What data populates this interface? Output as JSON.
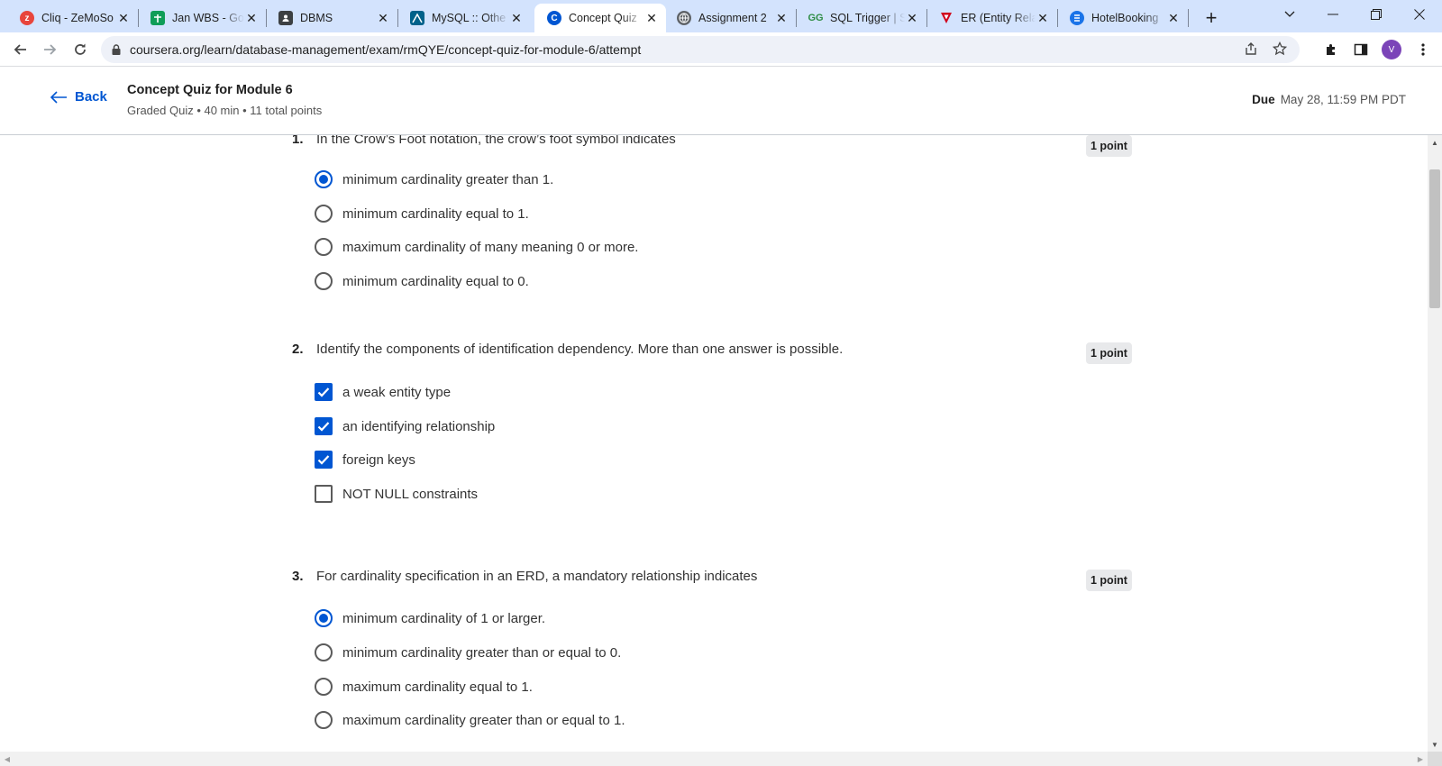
{
  "browser": {
    "tabs": [
      {
        "title": "Cliq - ZeMoSo",
        "icon": "zoho-cliq-icon",
        "color": "#e8453c"
      },
      {
        "title": "Jan WBS - Goo",
        "icon": "google-sheets-icon",
        "color": "#0f9d58"
      },
      {
        "title": "DBMS",
        "icon": "profile-card-icon",
        "color": "#3c4043"
      },
      {
        "title": "MySQL :: Othe",
        "icon": "mysql-icon",
        "color": "#00618a"
      },
      {
        "title": "Concept Quiz",
        "icon": "coursera-icon",
        "color": "#0056d2"
      },
      {
        "title": "Assignment 2",
        "icon": "globe-icon",
        "color": "#5f6368"
      },
      {
        "title": "SQL Trigger | S",
        "icon": "geeksforgeeks-icon",
        "color": "#2f8d46"
      },
      {
        "title": "ER (Entity Rela",
        "icon": "vertabelo-icon",
        "color": "#d0021b"
      },
      {
        "title": "HotelBooking",
        "icon": "database-icon",
        "color": "#1a73e8"
      }
    ],
    "active_tab_index": 4,
    "url": "coursera.org/learn/database-management/exam/rmQYE/concept-quiz-for-module-6/attempt",
    "profile_initial": "V"
  },
  "header": {
    "back_label": "Back",
    "title": "Concept Quiz for Module 6",
    "meta": "Graded Quiz • 40 min • 11 total points",
    "due_label": "Due",
    "due_value": "May 28, 11:59 PM PDT"
  },
  "questions": [
    {
      "number": "1.",
      "text": "In the Crow’s Foot notation, the crow’s foot symbol indicates",
      "points": "1 point",
      "type": "radio",
      "options": [
        {
          "label": "minimum cardinality greater than 1.",
          "selected": true
        },
        {
          "label": "minimum cardinality equal to 1.",
          "selected": false
        },
        {
          "label": "maximum cardinality of many meaning 0 or more.",
          "selected": false
        },
        {
          "label": "minimum cardinality equal to 0.",
          "selected": false
        }
      ]
    },
    {
      "number": "2.",
      "text": "Identify the components of identification dependency. More than one answer is possible.",
      "points": "1 point",
      "type": "checkbox",
      "options": [
        {
          "label": "a weak entity type",
          "selected": true
        },
        {
          "label": "an identifying relationship",
          "selected": true
        },
        {
          "label": "foreign keys",
          "selected": true
        },
        {
          "label": "NOT NULL constraints",
          "selected": false
        }
      ]
    },
    {
      "number": "3.",
      "text": "For cardinality specification in an ERD, a mandatory relationship indicates",
      "points": "1 point",
      "type": "radio",
      "options": [
        {
          "label": "minimum cardinality of 1 or larger.",
          "selected": true
        },
        {
          "label": "minimum cardinality greater than or equal to 0.",
          "selected": false
        },
        {
          "label": "maximum cardinality equal to 1.",
          "selected": false
        },
        {
          "label": "maximum cardinality greater than or equal to 1.",
          "selected": false
        }
      ]
    }
  ],
  "colors": {
    "accent": "#0056d2",
    "tabstrip": "#d3e3fd",
    "points_badge": "#e8e9eb"
  }
}
